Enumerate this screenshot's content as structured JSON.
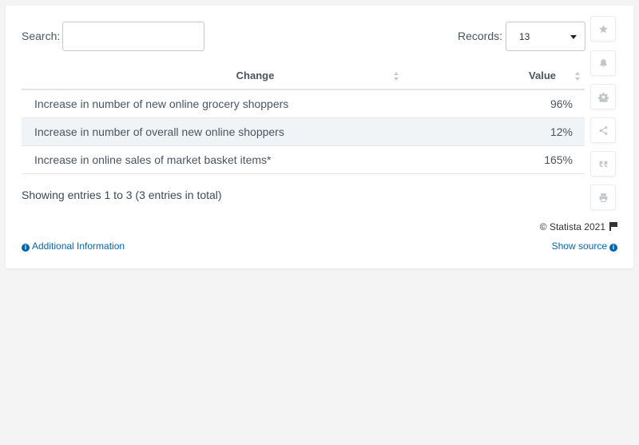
{
  "search": {
    "label": "Search:",
    "value": "",
    "placeholder": ""
  },
  "records": {
    "label": "Records:",
    "selected": "13"
  },
  "table": {
    "columns": [
      "Change",
      "Value"
    ],
    "rows": [
      {
        "change": "Increase in number of new online grocery shoppers",
        "value": "96%"
      },
      {
        "change": "Increase in number of overall new online shoppers",
        "value": "12%"
      },
      {
        "change": "Increase in online sales of market basket items*",
        "value": "165%"
      }
    ]
  },
  "footer": {
    "showing": "Showing entries 1 to 3 (3 entries in total)",
    "copyright": "© Statista 2021",
    "additional_info": "Additional Information",
    "show_source": "Show source"
  },
  "sidebar_icons": [
    "star-icon",
    "bell-icon",
    "gear-icon",
    "share-icon",
    "quote-icon",
    "print-icon"
  ],
  "colors": {
    "link": "#0066b3",
    "row_alt": "#f1f4f7",
    "icon": "#c0c6cc"
  }
}
